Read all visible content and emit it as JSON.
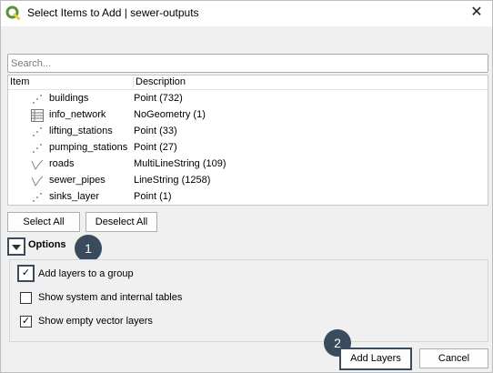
{
  "window": {
    "title": "Select Items to Add | sewer-outputs",
    "close_glyph": "✕",
    "app_icon": "qgis-logo-icon",
    "app_icon_color": "#589632"
  },
  "search": {
    "placeholder": "Search...",
    "value": ""
  },
  "tree": {
    "columns": [
      "Item",
      "Description"
    ],
    "rows": [
      {
        "icon": "point-layer-icon",
        "name": "buildings",
        "description": "Point (732)"
      },
      {
        "icon": "table-layer-icon",
        "name": "info_network",
        "description": "NoGeometry (1)"
      },
      {
        "icon": "point-layer-icon",
        "name": "lifting_stations",
        "description": "Point (33)"
      },
      {
        "icon": "point-layer-icon",
        "name": "pumping_stations",
        "description": "Point (27)"
      },
      {
        "icon": "line-layer-icon",
        "name": "roads",
        "description": "MultiLineString (109)"
      },
      {
        "icon": "line-layer-icon",
        "name": "sewer_pipes",
        "description": "LineString (1258)"
      },
      {
        "icon": "point-layer-icon",
        "name": "sinks_layer",
        "description": "Point (1)"
      }
    ]
  },
  "buttons": {
    "select_all": "Select All",
    "deselect_all": "Deselect All",
    "add_layers": "Add Layers",
    "cancel": "Cancel"
  },
  "options": {
    "title": "Options",
    "collapse_icon": "triangle-down-icon",
    "items": [
      {
        "label": "Add layers to a group",
        "checked": true,
        "check_glyph": "✓"
      },
      {
        "label": "Show system and internal tables",
        "checked": false,
        "check_glyph": ""
      },
      {
        "label": "Show empty vector layers",
        "checked": true,
        "check_glyph": "✓"
      }
    ]
  },
  "callouts": {
    "one": "1",
    "two": "2",
    "color": "#3a4b5e"
  }
}
